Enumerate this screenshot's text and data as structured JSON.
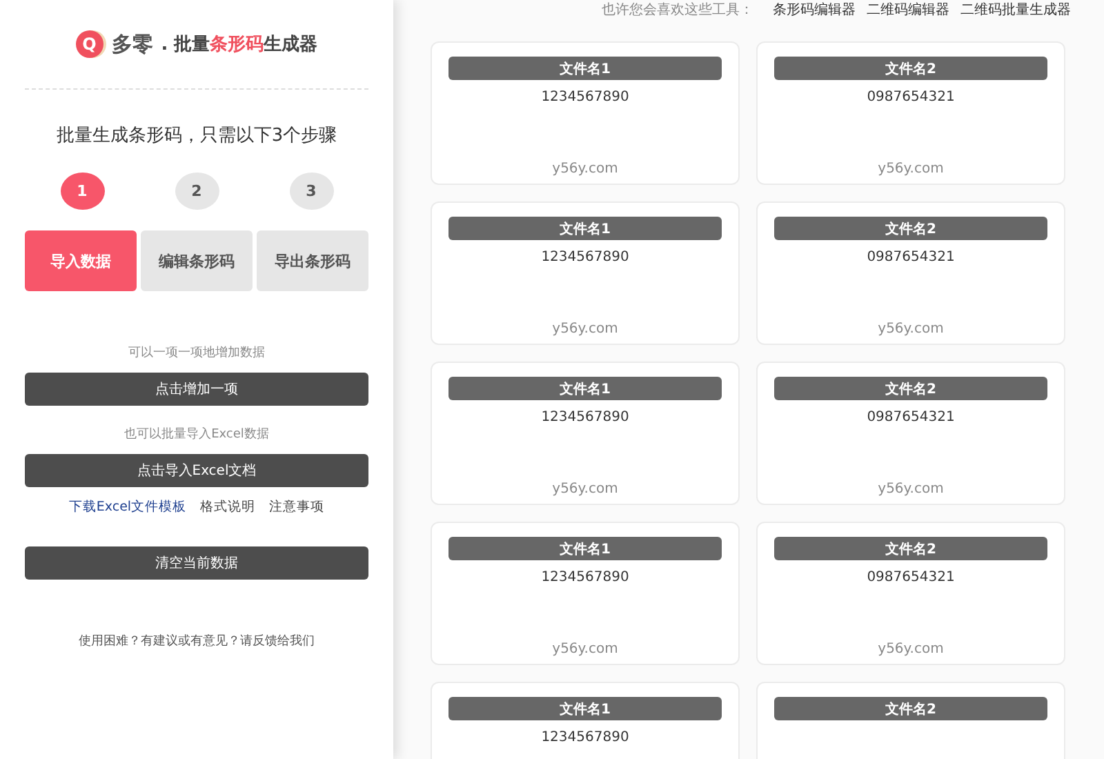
{
  "logo": {
    "mark": "Q",
    "brand": "多零",
    "separator": ".",
    "title_before": "批量",
    "title_highlight": "条形码",
    "title_after": "生成器"
  },
  "intro": "批量生成条形码，只需以下3个步骤",
  "steps": [
    {
      "number": "1",
      "label": "导入数据",
      "selected": true
    },
    {
      "number": "2",
      "label": "编辑条形码",
      "selected": false
    },
    {
      "number": "3",
      "label": "导出条形码",
      "selected": false
    }
  ],
  "add_hint": "可以一项一项地增加数据",
  "add_button": "点击增加一项",
  "import_hint": "也可以批量导入Excel数据",
  "import_button": "点击导入Excel文档",
  "links": [
    {
      "label": "下载Excel文件模板",
      "kind": "link"
    },
    {
      "label": "格式说明",
      "kind": "plain"
    },
    {
      "label": "注意事项",
      "kind": "plain"
    }
  ],
  "clear_button": "清空当前数据",
  "feedback": "使用困难？有建议或有意见？请反馈给我们",
  "tools_label": "也许您会喜欢这些工具：",
  "tools": [
    "条形码编辑器",
    "二维码编辑器",
    "二维码批量生成器"
  ],
  "cards": [
    {
      "title": "文件名1",
      "code": "1234567890",
      "footer": "y56y.com"
    },
    {
      "title": "文件名2",
      "code": "0987654321",
      "footer": "y56y.com"
    },
    {
      "title": "文件名1",
      "code": "1234567890",
      "footer": "y56y.com"
    },
    {
      "title": "文件名2",
      "code": "0987654321",
      "footer": "y56y.com"
    },
    {
      "title": "文件名1",
      "code": "1234567890",
      "footer": "y56y.com"
    },
    {
      "title": "文件名2",
      "code": "0987654321",
      "footer": "y56y.com"
    },
    {
      "title": "文件名1",
      "code": "1234567890",
      "footer": "y56y.com"
    },
    {
      "title": "文件名2",
      "code": "0987654321",
      "footer": "y56y.com"
    },
    {
      "title": "文件名1",
      "code": "1234567890"
    },
    {
      "title": "文件名2"
    }
  ]
}
